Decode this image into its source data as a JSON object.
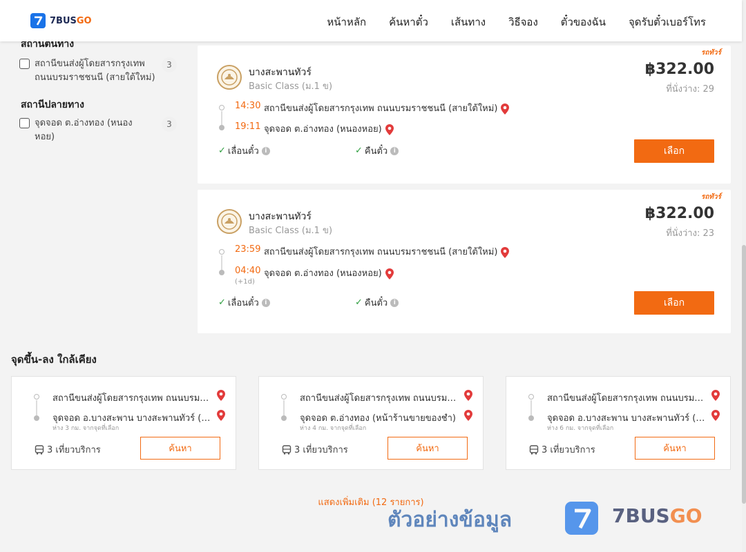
{
  "header": {
    "logo_text_main": "7BUS",
    "logo_text_accent": "GO",
    "nav": [
      "หน้าหลัก",
      "ค้นหาตั๋ว",
      "เส้นทาง",
      "วิธีจอง",
      "ตั๋วของฉัน",
      "จุดรับตั๋วเบอร์โทร"
    ]
  },
  "sidebar": {
    "origin_title": "สถานีต้นทาง",
    "origin_item": {
      "label": "สถานีขนส่งผู้โดยสารกรุงเทพ ถนนบรมราชชนนี (สายใต้ใหม่)",
      "count": "3"
    },
    "destination_title": "สถานีปลายทาง",
    "destination_item": {
      "label": "จุดจอด ต.อ่างทอง (หนองหอย)",
      "count": "3"
    }
  },
  "trips": [
    {
      "badge": "รถทัวร์",
      "operator": "บางสะพานทัวร์",
      "class": "Basic Class (ม.1 ข)",
      "price": "฿322.00",
      "seats": "ที่นั่งว่าง: 29",
      "depart_time": "14:30",
      "depart_stop": "สถานีขนส่งผู้โดยสารกรุงเทพ ถนนบรมราชชนนี (สายใต้ใหม่)",
      "arrive_time": "19:11",
      "arrive_stop": "จุดจอด ต.อ่างทอง (หนองหอย)",
      "next_day": "",
      "feature_1": "เลื่อนตั๋ว",
      "feature_2": "คืนตั๋ว",
      "select_label": "เลือก"
    },
    {
      "badge": "รถทัวร์",
      "operator": "บางสะพานทัวร์",
      "class": "Basic Class (ม.1 ข)",
      "price": "฿322.00",
      "seats": "ที่นั่งว่าง: 23",
      "depart_time": "23:59",
      "depart_stop": "สถานีขนส่งผู้โดยสารกรุงเทพ ถนนบรมราชชนนี (สายใต้ใหม่)",
      "arrive_time": "04:40",
      "arrive_stop": "จุดจอด ต.อ่างทอง (หนองหอย)",
      "next_day": "(+1d)",
      "feature_1": "เลื่อนตั๋ว",
      "feature_2": "คืนตั๋ว",
      "select_label": "เลือก"
    }
  ],
  "nearby": {
    "title": "จุดขึ้น-ลง ใกล้เคียง",
    "cards": [
      {
        "from": "สถานีขนส่งผู้โดยสารกรุงเทพ ถนนบรมราชชนนี (สายใต้ใหม่)",
        "to": "จุดจอด อ.บางสะพาน บางสะพานทัวร์ (ทางหลวง)",
        "distance": "ห่าง 3 กม. จากจุดที่เลือก",
        "trips": "3 เที่ยวบริการ",
        "button": "ค้นหา"
      },
      {
        "from": "สถานีขนส่งผู้โดยสารกรุงเทพ ถนนบรมราชชนนี (สายใต้ใหม่)",
        "to": "จุดจอด ต.อ่างทอง (หน้าร้านขายของชำ)",
        "distance": "ห่าง 4 กม. จากจุดที่เลือก",
        "trips": "3 เที่ยวบริการ",
        "button": "ค้นหา"
      },
      {
        "from": "สถานีขนส่งผู้โดยสารกรุงเทพ ถนนบรมราชชนนี (สายใต้ใหม่)",
        "to": "จุดจอด อ.บางสะพาน บางสะพานทัวร์ (ทางหลวง)",
        "distance": "ห่าง 6 กม. จากจุดที่เลือก",
        "trips": "3 เที่ยวบริการ",
        "button": "ค้นหา"
      }
    ]
  },
  "show_more": "แสดงเพิ่มเติม (12 รายการ)",
  "watermark": {
    "text": "ตัวอย่างข้อมูล",
    "brand_main": "7BUS",
    "brand_accent": "GO"
  },
  "colors": {
    "accent": "#f26a12",
    "brand_blue": "#1a73e8",
    "check_green": "#2e9e3f",
    "pin_red": "#e23b3b"
  }
}
